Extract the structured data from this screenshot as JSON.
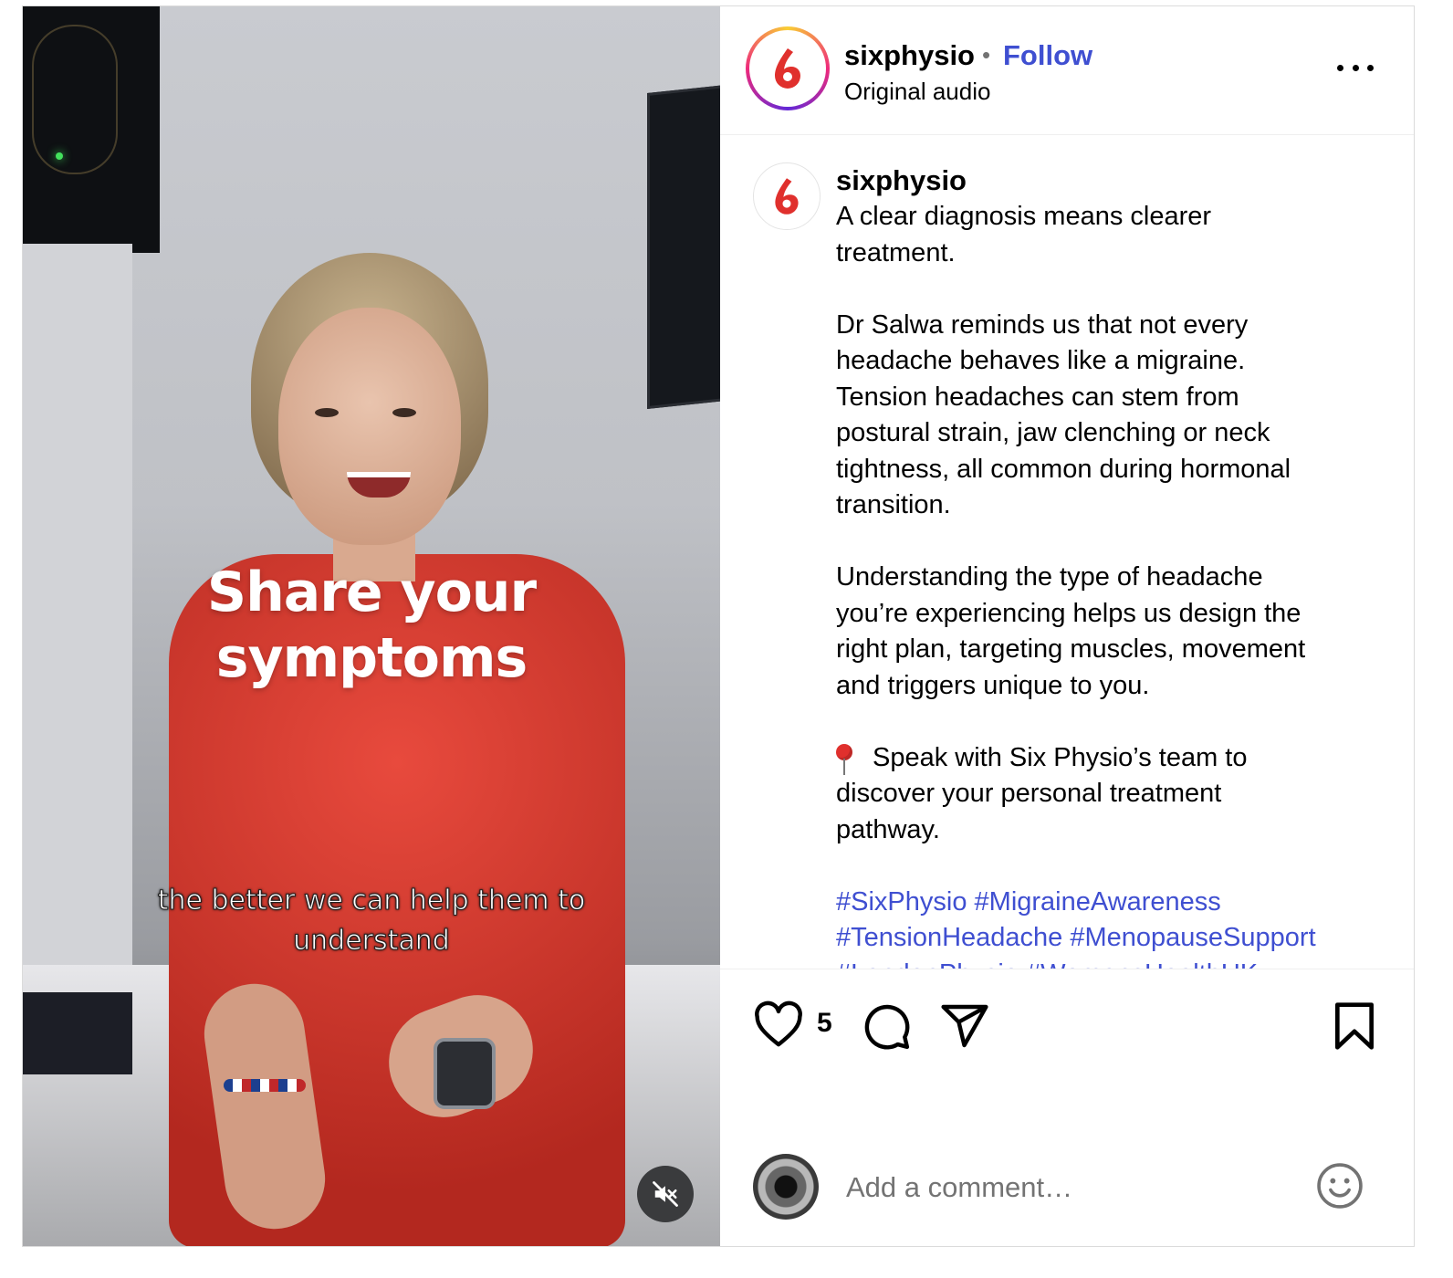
{
  "video": {
    "overlay_title_line1": "Share your",
    "overlay_title_line2": "symptoms",
    "caption_line1": "the better we can help them to",
    "caption_line2": "understand",
    "mute_icon": "speaker-muted-icon"
  },
  "header": {
    "username": "sixphysio",
    "separator": "•",
    "follow_label": "Follow",
    "audio_label": "Original audio",
    "more_icon": "more-horizontal-icon"
  },
  "caption": {
    "username": "sixphysio",
    "lines": [
      "A clear diagnosis means clearer",
      "treatment.",
      "",
      "Dr Salwa reminds us that not every",
      "headache behaves like a migraine.",
      "Tension headaches can stem from",
      "postural strain, jaw clenching or neck",
      "tightness, all common during hormonal",
      "transition.",
      "",
      "Understanding the type of headache",
      "you’re experiencing helps us design the",
      "right plan, targeting muscles, movement",
      "and triggers unique to you."
    ],
    "cta_line1": "Speak with Six Physio’s team to",
    "cta_line2": "discover your personal treatment",
    "cta_line3": "pathway.",
    "pin_icon": "round-pushpin-icon",
    "hashtags": [
      "#SixPhysio",
      "#MigraineAwareness",
      "#TensionHeadache",
      "#MenopauseSupport",
      "#LondonPhysio",
      "#WomensHealthUK"
    ]
  },
  "actions": {
    "like_count": "5",
    "icons": [
      "heart-icon",
      "comment-icon",
      "share-icon",
      "bookmark-icon"
    ]
  },
  "comment_box": {
    "placeholder": "Add a comment…",
    "emoji_icon": "smiley-icon"
  },
  "colors": {
    "link_blue": "#3f4fd1",
    "brand_red": "#e0302d",
    "muted_text": "#737373",
    "border": "#dbdbdb"
  }
}
